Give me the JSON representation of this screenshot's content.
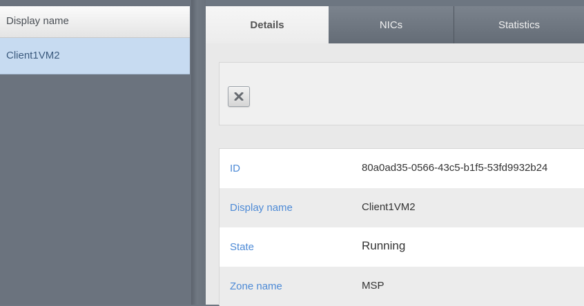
{
  "list": {
    "header": "Display name",
    "rows": [
      "Client1VM2"
    ]
  },
  "tabs": [
    {
      "label": "Details",
      "active": true
    },
    {
      "label": "NICs",
      "active": false
    },
    {
      "label": "Statistics",
      "active": false
    }
  ],
  "toolbar": {
    "remove_icon": "x-icon"
  },
  "details": [
    {
      "label": "ID",
      "value": "80a0ad35-0566-43c5-b1f5-53fd9932b24"
    },
    {
      "label": "Display name",
      "value": "Client1VM2"
    },
    {
      "label": "State",
      "value": "Running"
    },
    {
      "label": "Zone name",
      "value": "MSP"
    }
  ],
  "colors": {
    "accent_label": "#4d8ad6",
    "selected_row": "#c7dbf1",
    "panel_dark": "#6b737e"
  }
}
